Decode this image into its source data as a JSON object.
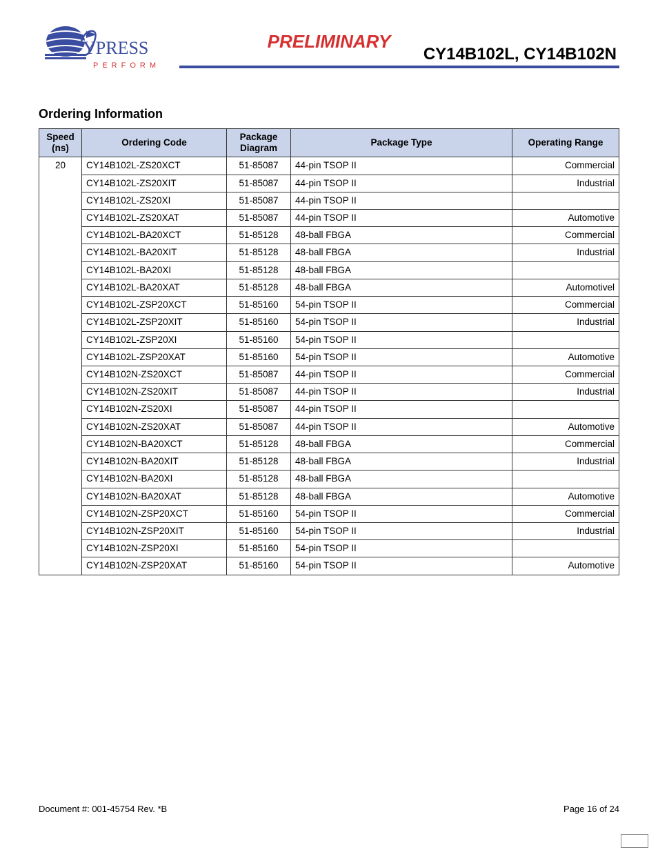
{
  "header": {
    "preliminary": "PRELIMINARY",
    "doc_title": "CY14B102L, CY14B102N",
    "logo_text": "YPRESS",
    "logo_perform": "PERFORM"
  },
  "section": {
    "heading": "Ordering Information"
  },
  "table": {
    "headers": {
      "speed": "Speed (ns)",
      "code": "Ordering Code",
      "diagram": "Package Diagram",
      "type": "Package Type",
      "range": "Operating Range"
    },
    "speed_value": "20",
    "rows": [
      {
        "code": "CY14B102L-ZS20XCT",
        "diagram": "51-85087",
        "type": "44-pin TSOP II",
        "range": "Commercial"
      },
      {
        "code": "CY14B102L-ZS20XIT",
        "diagram": "51-85087",
        "type": "44-pin TSOP II",
        "range": "Industrial"
      },
      {
        "code": "CY14B102L-ZS20XI",
        "diagram": "51-85087",
        "type": "44-pin TSOP II",
        "range": ""
      },
      {
        "code": "CY14B102L-ZS20XAT",
        "diagram": "51-85087",
        "type": "44-pin TSOP II",
        "range": "Automotive"
      },
      {
        "code": "CY14B102L-BA20XCT",
        "diagram": "51-85128",
        "type": "48-ball FBGA",
        "range": "Commercial"
      },
      {
        "code": "CY14B102L-BA20XIT",
        "diagram": "51-85128",
        "type": "48-ball FBGA",
        "range": "Industrial"
      },
      {
        "code": "CY14B102L-BA20XI",
        "diagram": "51-85128",
        "type": "48-ball FBGA",
        "range": ""
      },
      {
        "code": "CY14B102L-BA20XAT",
        "diagram": "51-85128",
        "type": "48-ball FBGA",
        "range": "Automotivel"
      },
      {
        "code": "CY14B102L-ZSP20XCT",
        "diagram": "51-85160",
        "type": "54-pin TSOP II",
        "range": "Commercial"
      },
      {
        "code": "CY14B102L-ZSP20XIT",
        "diagram": "51-85160",
        "type": "54-pin TSOP II",
        "range": "Industrial"
      },
      {
        "code": "CY14B102L-ZSP20XI",
        "diagram": "51-85160",
        "type": "54-pin TSOP II",
        "range": ""
      },
      {
        "code": "CY14B102L-ZSP20XAT",
        "diagram": "51-85160",
        "type": "54-pin TSOP II",
        "range": "Automotive"
      },
      {
        "code": "CY14B102N-ZS20XCT",
        "diagram": "51-85087",
        "type": "44-pin TSOP II",
        "range": "Commercial"
      },
      {
        "code": "CY14B102N-ZS20XIT",
        "diagram": "51-85087",
        "type": "44-pin TSOP II",
        "range": "Industrial"
      },
      {
        "code": "CY14B102N-ZS20XI",
        "diagram": "51-85087",
        "type": "44-pin TSOP II",
        "range": ""
      },
      {
        "code": "CY14B102N-ZS20XAT",
        "diagram": "51-85087",
        "type": "44-pin TSOP II",
        "range": "Automotive"
      },
      {
        "code": "CY14B102N-BA20XCT",
        "diagram": "51-85128",
        "type": "48-ball FBGA",
        "range": "Commercial"
      },
      {
        "code": "CY14B102N-BA20XIT",
        "diagram": "51-85128",
        "type": "48-ball FBGA",
        "range": "Industrial"
      },
      {
        "code": "CY14B102N-BA20XI",
        "diagram": "51-85128",
        "type": "48-ball FBGA",
        "range": ""
      },
      {
        "code": "CY14B102N-BA20XAT",
        "diagram": "51-85128",
        "type": "48-ball FBGA",
        "range": "Automotive"
      },
      {
        "code": "CY14B102N-ZSP20XCT",
        "diagram": "51-85160",
        "type": "54-pin TSOP II",
        "range": "Commercial"
      },
      {
        "code": "CY14B102N-ZSP20XIT",
        "diagram": "51-85160",
        "type": "54-pin TSOP II",
        "range": "Industrial"
      },
      {
        "code": "CY14B102N-ZSP20XI",
        "diagram": "51-85160",
        "type": "54-pin TSOP II",
        "range": ""
      },
      {
        "code": "CY14B102N-ZSP20XAT",
        "diagram": "51-85160",
        "type": "54-pin TSOP II",
        "range": "Automotive"
      }
    ]
  },
  "footer": {
    "doc_number": "Document #: 001-45754 Rev. *B",
    "page": "Page 16 of 24"
  }
}
